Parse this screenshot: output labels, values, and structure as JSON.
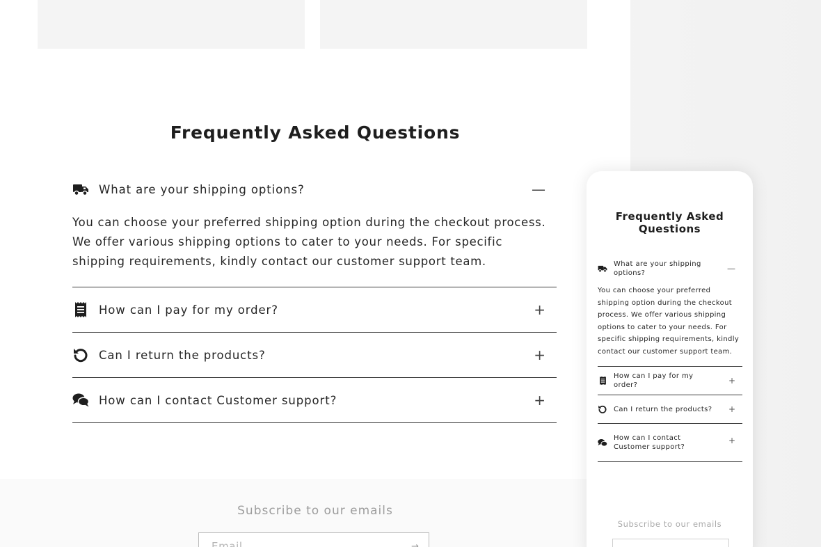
{
  "faq": {
    "title": "Frequently Asked Questions",
    "items": [
      {
        "icon": "truck-icon",
        "question": "What are your shipping options?",
        "toggle": "—",
        "answer": "You can choose your preferred shipping option during the checkout process. We offer various shipping options to cater to your needs. For specific shipping requirements, kindly contact our customer support team."
      },
      {
        "icon": "receipt-icon",
        "question": "How can I pay for my order?",
        "toggle": "+"
      },
      {
        "icon": "return-icon",
        "question": "Can I return the products?",
        "toggle": "+"
      },
      {
        "icon": "chat-icon",
        "question": "How can I contact Customer support?",
        "toggle": "+"
      }
    ]
  },
  "subscribe": {
    "title": "Subscribe to our emails",
    "email_placeholder": "Email",
    "submit_arrow": "→"
  },
  "mobile": {
    "faq_title": "Frequently Asked Questions",
    "items": [
      {
        "question": "What are your shipping options?",
        "toggle": "—",
        "answer": "You can choose your preferred shipping option during the checkout process. We offer various shipping options to cater to your needs. For specific shipping requirements, kindly contact our customer support team."
      },
      {
        "question": "How can I pay for my order?",
        "toggle": "+"
      },
      {
        "question": "Can I return the products?",
        "toggle": "+"
      },
      {
        "question": "How can I contact Customer support?",
        "toggle": "+"
      }
    ],
    "subscribe_title": "Subscribe to our emails"
  },
  "colors": {
    "text": "#1e1e1e",
    "divider": "#3a3a3a",
    "muted": "#9d9d9d",
    "tile": "#f4f4f4"
  }
}
